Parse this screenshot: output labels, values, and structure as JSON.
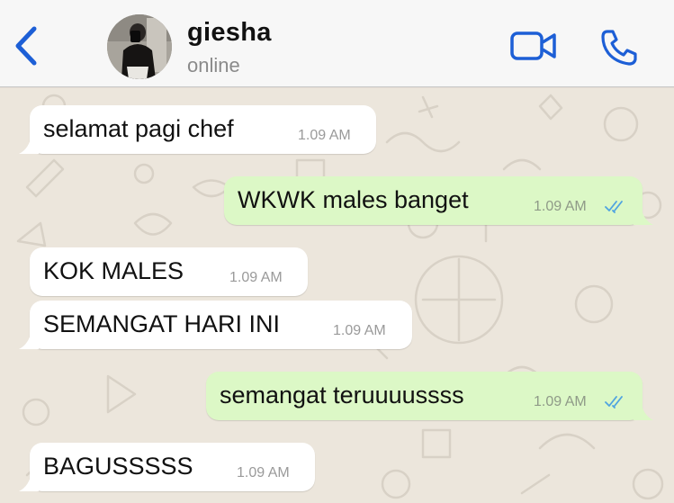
{
  "header": {
    "name": "giesha",
    "status": "online"
  },
  "messages": [
    {
      "direction": "incoming",
      "text": "selamat pagi chef",
      "time": "1.09 AM"
    },
    {
      "direction": "outgoing",
      "text": "WKWK males banget",
      "time": "1.09 AM",
      "read": true
    },
    {
      "direction": "incoming",
      "text": "KOK MALES",
      "time": "1.09 AM"
    },
    {
      "direction": "incoming",
      "text": "SEMANGAT HARI INI",
      "time": "1.09 AM"
    },
    {
      "direction": "outgoing",
      "text": "semangat teruuuussss",
      "time": "1.09 AM",
      "read": true
    },
    {
      "direction": "incoming",
      "text": "BAGUSSSSS",
      "time": "1.09 AM"
    }
  ],
  "icons": {
    "back": "chevron-left-icon",
    "video": "video-camera-icon",
    "call": "phone-icon",
    "read_receipt": "double-check-icon"
  },
  "colors": {
    "accent": "#1d5fd6",
    "incoming_bubble": "#ffffff",
    "outgoing_bubble": "#dcf8c6",
    "read_ticks": "#4fa3e0",
    "chat_background": "#ece6dc"
  }
}
